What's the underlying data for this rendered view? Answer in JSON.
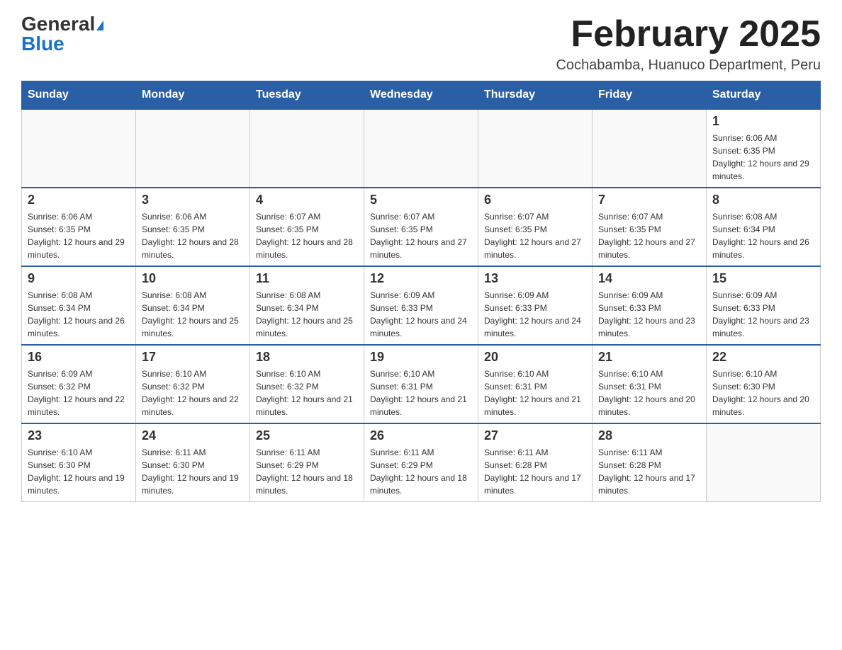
{
  "logo": {
    "general": "General",
    "blue": "Blue"
  },
  "title": "February 2025",
  "subtitle": "Cochabamba, Huanuco Department, Peru",
  "weekdays": [
    "Sunday",
    "Monday",
    "Tuesday",
    "Wednesday",
    "Thursday",
    "Friday",
    "Saturday"
  ],
  "weeks": [
    [
      {
        "day": "",
        "sunrise": "",
        "sunset": "",
        "daylight": ""
      },
      {
        "day": "",
        "sunrise": "",
        "sunset": "",
        "daylight": ""
      },
      {
        "day": "",
        "sunrise": "",
        "sunset": "",
        "daylight": ""
      },
      {
        "day": "",
        "sunrise": "",
        "sunset": "",
        "daylight": ""
      },
      {
        "day": "",
        "sunrise": "",
        "sunset": "",
        "daylight": ""
      },
      {
        "day": "",
        "sunrise": "",
        "sunset": "",
        "daylight": ""
      },
      {
        "day": "1",
        "sunrise": "Sunrise: 6:06 AM",
        "sunset": "Sunset: 6:35 PM",
        "daylight": "Daylight: 12 hours and 29 minutes."
      }
    ],
    [
      {
        "day": "2",
        "sunrise": "Sunrise: 6:06 AM",
        "sunset": "Sunset: 6:35 PM",
        "daylight": "Daylight: 12 hours and 29 minutes."
      },
      {
        "day": "3",
        "sunrise": "Sunrise: 6:06 AM",
        "sunset": "Sunset: 6:35 PM",
        "daylight": "Daylight: 12 hours and 28 minutes."
      },
      {
        "day": "4",
        "sunrise": "Sunrise: 6:07 AM",
        "sunset": "Sunset: 6:35 PM",
        "daylight": "Daylight: 12 hours and 28 minutes."
      },
      {
        "day": "5",
        "sunrise": "Sunrise: 6:07 AM",
        "sunset": "Sunset: 6:35 PM",
        "daylight": "Daylight: 12 hours and 27 minutes."
      },
      {
        "day": "6",
        "sunrise": "Sunrise: 6:07 AM",
        "sunset": "Sunset: 6:35 PM",
        "daylight": "Daylight: 12 hours and 27 minutes."
      },
      {
        "day": "7",
        "sunrise": "Sunrise: 6:07 AM",
        "sunset": "Sunset: 6:35 PM",
        "daylight": "Daylight: 12 hours and 27 minutes."
      },
      {
        "day": "8",
        "sunrise": "Sunrise: 6:08 AM",
        "sunset": "Sunset: 6:34 PM",
        "daylight": "Daylight: 12 hours and 26 minutes."
      }
    ],
    [
      {
        "day": "9",
        "sunrise": "Sunrise: 6:08 AM",
        "sunset": "Sunset: 6:34 PM",
        "daylight": "Daylight: 12 hours and 26 minutes."
      },
      {
        "day": "10",
        "sunrise": "Sunrise: 6:08 AM",
        "sunset": "Sunset: 6:34 PM",
        "daylight": "Daylight: 12 hours and 25 minutes."
      },
      {
        "day": "11",
        "sunrise": "Sunrise: 6:08 AM",
        "sunset": "Sunset: 6:34 PM",
        "daylight": "Daylight: 12 hours and 25 minutes."
      },
      {
        "day": "12",
        "sunrise": "Sunrise: 6:09 AM",
        "sunset": "Sunset: 6:33 PM",
        "daylight": "Daylight: 12 hours and 24 minutes."
      },
      {
        "day": "13",
        "sunrise": "Sunrise: 6:09 AM",
        "sunset": "Sunset: 6:33 PM",
        "daylight": "Daylight: 12 hours and 24 minutes."
      },
      {
        "day": "14",
        "sunrise": "Sunrise: 6:09 AM",
        "sunset": "Sunset: 6:33 PM",
        "daylight": "Daylight: 12 hours and 23 minutes."
      },
      {
        "day": "15",
        "sunrise": "Sunrise: 6:09 AM",
        "sunset": "Sunset: 6:33 PM",
        "daylight": "Daylight: 12 hours and 23 minutes."
      }
    ],
    [
      {
        "day": "16",
        "sunrise": "Sunrise: 6:09 AM",
        "sunset": "Sunset: 6:32 PM",
        "daylight": "Daylight: 12 hours and 22 minutes."
      },
      {
        "day": "17",
        "sunrise": "Sunrise: 6:10 AM",
        "sunset": "Sunset: 6:32 PM",
        "daylight": "Daylight: 12 hours and 22 minutes."
      },
      {
        "day": "18",
        "sunrise": "Sunrise: 6:10 AM",
        "sunset": "Sunset: 6:32 PM",
        "daylight": "Daylight: 12 hours and 21 minutes."
      },
      {
        "day": "19",
        "sunrise": "Sunrise: 6:10 AM",
        "sunset": "Sunset: 6:31 PM",
        "daylight": "Daylight: 12 hours and 21 minutes."
      },
      {
        "day": "20",
        "sunrise": "Sunrise: 6:10 AM",
        "sunset": "Sunset: 6:31 PM",
        "daylight": "Daylight: 12 hours and 21 minutes."
      },
      {
        "day": "21",
        "sunrise": "Sunrise: 6:10 AM",
        "sunset": "Sunset: 6:31 PM",
        "daylight": "Daylight: 12 hours and 20 minutes."
      },
      {
        "day": "22",
        "sunrise": "Sunrise: 6:10 AM",
        "sunset": "Sunset: 6:30 PM",
        "daylight": "Daylight: 12 hours and 20 minutes."
      }
    ],
    [
      {
        "day": "23",
        "sunrise": "Sunrise: 6:10 AM",
        "sunset": "Sunset: 6:30 PM",
        "daylight": "Daylight: 12 hours and 19 minutes."
      },
      {
        "day": "24",
        "sunrise": "Sunrise: 6:11 AM",
        "sunset": "Sunset: 6:30 PM",
        "daylight": "Daylight: 12 hours and 19 minutes."
      },
      {
        "day": "25",
        "sunrise": "Sunrise: 6:11 AM",
        "sunset": "Sunset: 6:29 PM",
        "daylight": "Daylight: 12 hours and 18 minutes."
      },
      {
        "day": "26",
        "sunrise": "Sunrise: 6:11 AM",
        "sunset": "Sunset: 6:29 PM",
        "daylight": "Daylight: 12 hours and 18 minutes."
      },
      {
        "day": "27",
        "sunrise": "Sunrise: 6:11 AM",
        "sunset": "Sunset: 6:28 PM",
        "daylight": "Daylight: 12 hours and 17 minutes."
      },
      {
        "day": "28",
        "sunrise": "Sunrise: 6:11 AM",
        "sunset": "Sunset: 6:28 PM",
        "daylight": "Daylight: 12 hours and 17 minutes."
      },
      {
        "day": "",
        "sunrise": "",
        "sunset": "",
        "daylight": ""
      }
    ]
  ]
}
